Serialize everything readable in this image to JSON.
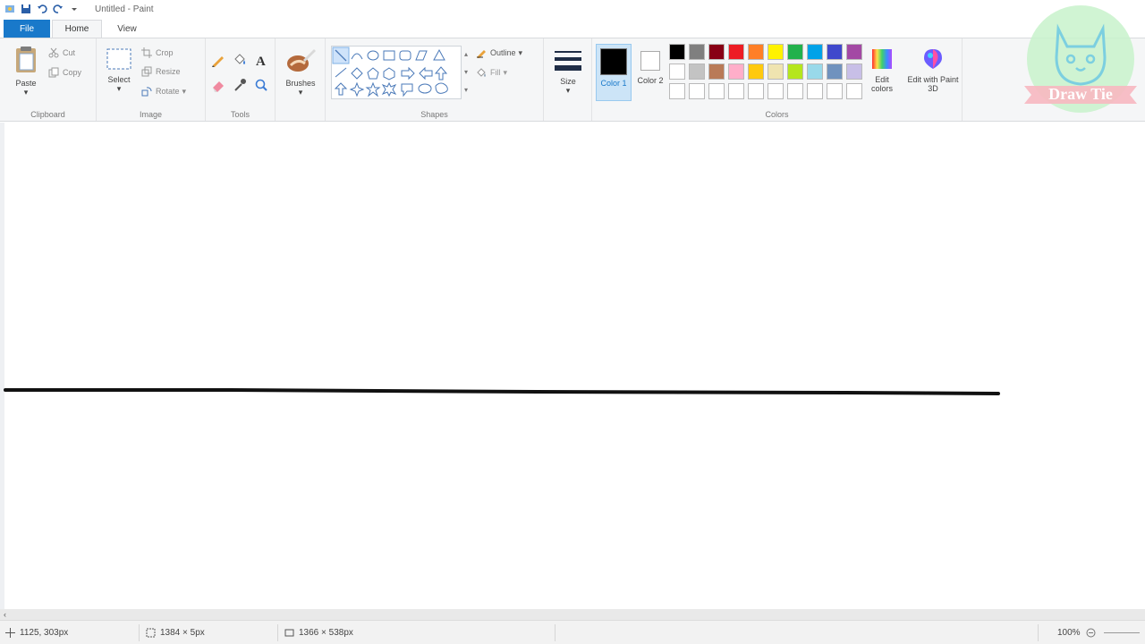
{
  "window": {
    "title": "Untitled - Paint"
  },
  "tabs": {
    "file": "File",
    "home": "Home",
    "view": "View"
  },
  "clipboard": {
    "paste": "Paste",
    "cut": "Cut",
    "copy": "Copy",
    "label": "Clipboard"
  },
  "image": {
    "select": "Select",
    "crop": "Crop",
    "resize": "Resize",
    "rotate": "Rotate",
    "label": "Image"
  },
  "tools": {
    "label": "Tools"
  },
  "brushes": {
    "label": "Brushes"
  },
  "shapes": {
    "outline": "Outline",
    "fill": "Fill",
    "label": "Shapes"
  },
  "size": {
    "label": "Size"
  },
  "colors": {
    "color1": "Color 1",
    "color2": "Color 2",
    "edit_colors": "Edit colors",
    "edit_paint3d": "Edit with Paint 3D",
    "label": "Colors",
    "active_color": "#000000",
    "palette_row1": [
      "#000000",
      "#7f7f7f",
      "#880015",
      "#ed1c24",
      "#ff7f27",
      "#fff200",
      "#22b14c",
      "#00a2e8",
      "#3f48cc",
      "#a349a4"
    ],
    "palette_row2": [
      "#ffffff",
      "#c3c3c3",
      "#b97a57",
      "#ffaec9",
      "#ffc90e",
      "#efe4b0",
      "#b5e61d",
      "#99d9ea",
      "#7092be",
      "#c8bfe7"
    ]
  },
  "status": {
    "cursor": "1125, 303px",
    "selection": "1384 × 5px",
    "canvas_size": "1366 × 538px",
    "zoom": "100%"
  },
  "watermark": {
    "text": "Draw Tie"
  }
}
